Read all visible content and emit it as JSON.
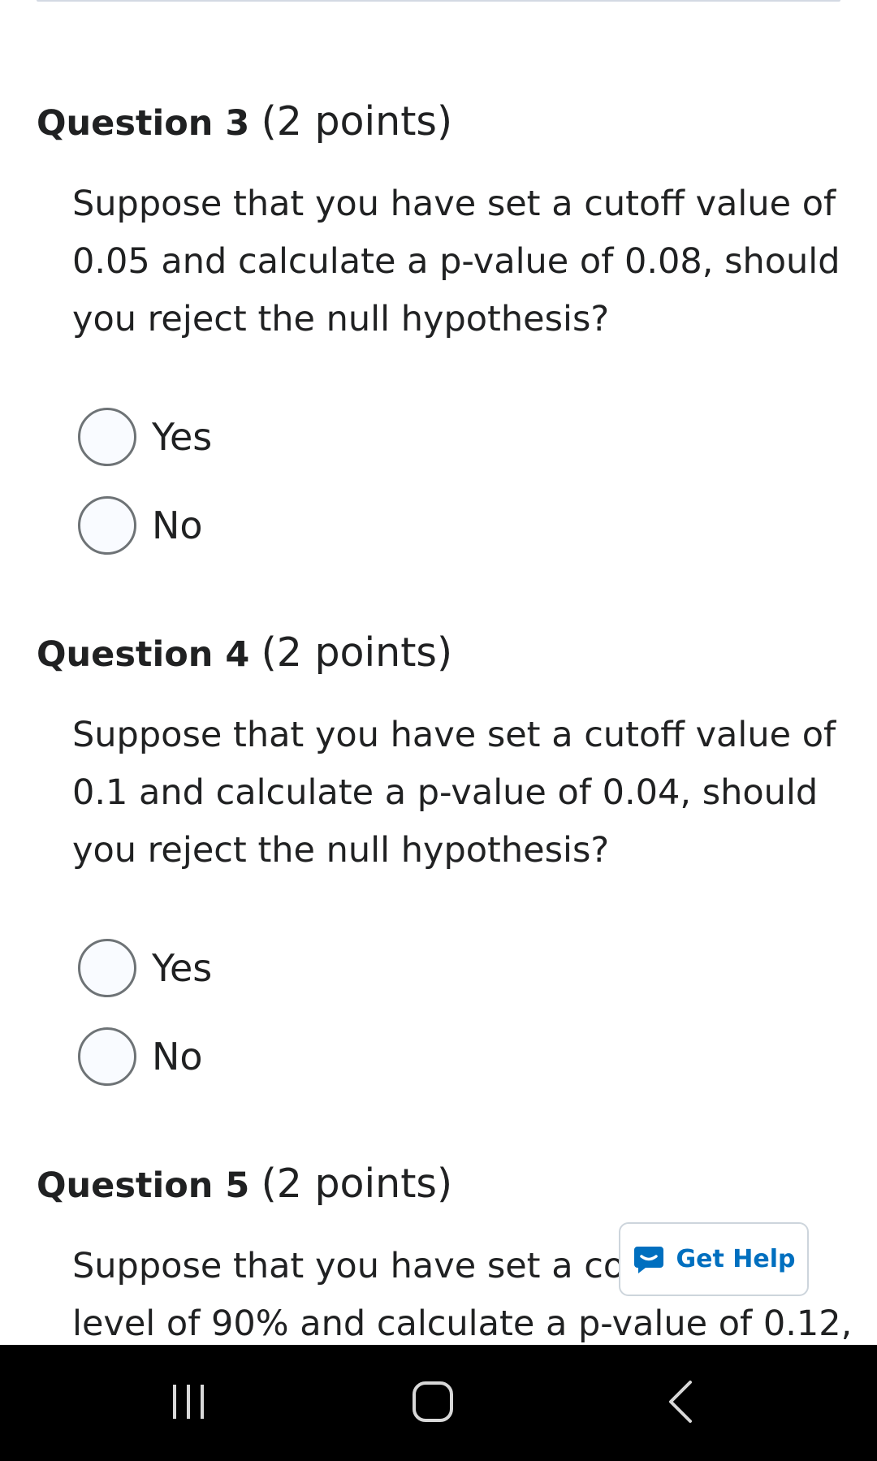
{
  "questions": [
    {
      "number_label": "Question 3",
      "points_label": "(2 points)",
      "text_lines": [
        "Suppose that you have set a cutoff value of",
        "0.05 and calculate a p-value of 0.08, should",
        "you reject the null hypothesis?"
      ],
      "options": [
        "Yes",
        "No"
      ]
    },
    {
      "number_label": "Question 4",
      "points_label": "(2 points)",
      "text_lines": [
        "Suppose that you have set a cutoff value of",
        "0.1 and calculate a p-value of 0.04, should",
        "you reject the null hypothesis?"
      ],
      "options": [
        "Yes",
        "No"
      ]
    },
    {
      "number_label": "Question 5",
      "points_label": "(2 points)",
      "text_lines": [
        "Suppose that you have set a co",
        "level of 90% and calculate a p-value of 0.12,"
      ],
      "options": []
    }
  ],
  "get_help": {
    "label": "Get Help",
    "icon": "chat-bubble-icon"
  },
  "android_nav": {
    "recents_icon": "recent-apps-icon",
    "home_icon": "home-icon",
    "back_icon": "back-icon"
  },
  "colors": {
    "text": "#202122",
    "radio_border": "#6e7376",
    "radio_fill": "#f9fbff",
    "help_accent": "#006fbf",
    "nav_bar": "#000000"
  }
}
